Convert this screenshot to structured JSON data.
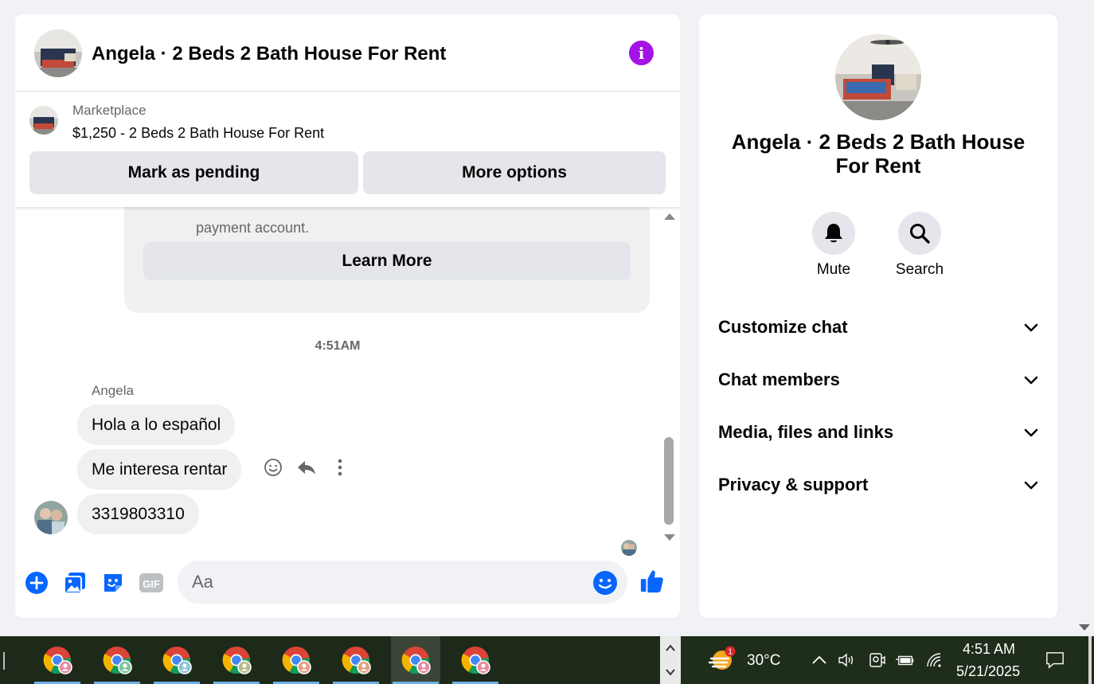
{
  "chat": {
    "title": "Angela · 2 Beds 2 Bath House For Rent",
    "info_icon": "info-icon",
    "marketplace": {
      "label": "Marketplace",
      "listing": "$1,250 - 2 Beds 2 Bath House For Rent",
      "mark_pending_label": "Mark as pending",
      "more_options_label": "More options"
    },
    "info_card": {
      "text": "payment account.",
      "learn_more_label": "Learn More"
    },
    "timestamp": "4:51AM",
    "sender_name": "Angela",
    "messages": [
      {
        "text": "Hola a lo español"
      },
      {
        "text": "Me interesa rentar"
      },
      {
        "text": "3319803310"
      }
    ],
    "message_actions": [
      "smiley-react-icon",
      "reply-icon",
      "more-vertical-icon"
    ],
    "composer": {
      "placeholder": "Aa",
      "icons": [
        "plus-circle-icon",
        "photo-icon",
        "sticker-icon",
        "gif-icon",
        "emoji-icon",
        "thumbs-up-icon"
      ]
    }
  },
  "info_panel": {
    "title": "Angela · 2 Beds 2 Bath House For Rent",
    "actions": [
      {
        "label": "Mute",
        "icon": "bell-icon"
      },
      {
        "label": "Search",
        "icon": "search-icon"
      }
    ],
    "sections": [
      {
        "label": "Customize chat"
      },
      {
        "label": "Chat members"
      },
      {
        "label": "Media, files and links"
      },
      {
        "label": "Privacy & support"
      }
    ]
  },
  "taskbar": {
    "apps": [
      "chrome-icon",
      "chrome-icon",
      "chrome-icon",
      "chrome-icon",
      "chrome-icon",
      "chrome-icon",
      "chrome-icon",
      "chrome-icon"
    ],
    "weather": {
      "temperature": "30°C",
      "badge": "1"
    },
    "time": "4:51 AM",
    "date": "5/21/2025"
  },
  "colors": {
    "accent_blue": "#0866ff",
    "info_purple": "#a313e6",
    "bubble_gray": "#f0f0f0",
    "taskbar_bg": "#1f2d1b"
  }
}
